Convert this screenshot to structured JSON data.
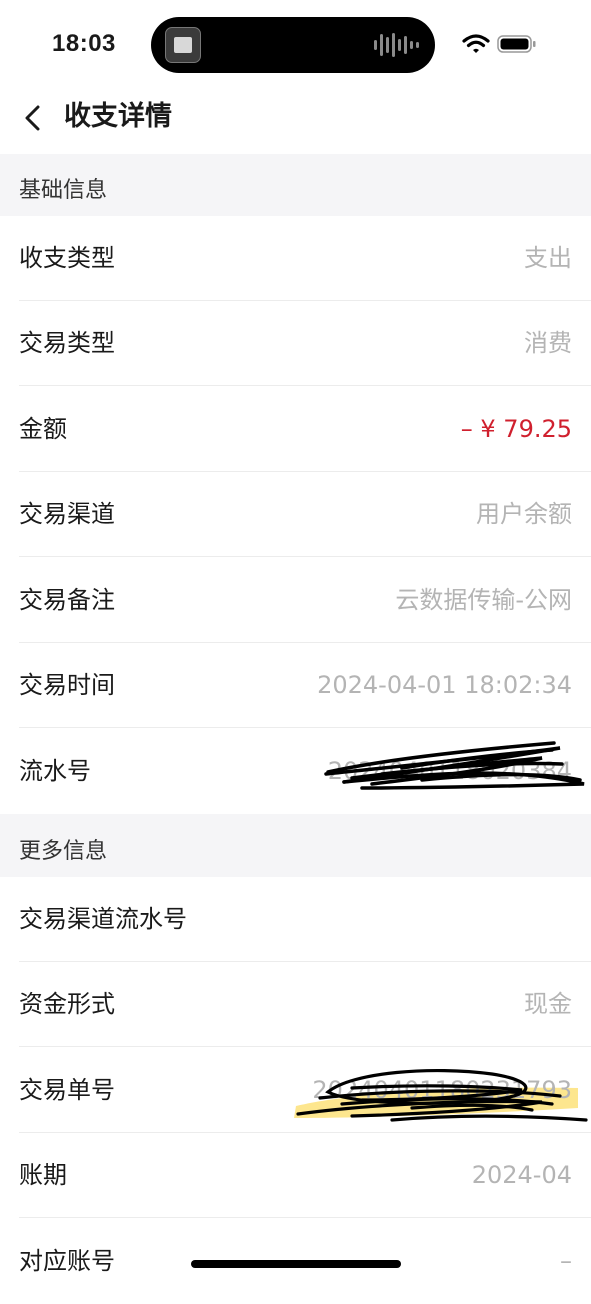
{
  "status_bar": {
    "time": "18:03"
  },
  "nav": {
    "title": "收支详情"
  },
  "sections": [
    {
      "header": "基础信息",
      "rows": [
        {
          "label": "收支类型",
          "value": "支出"
        },
        {
          "label": "交易类型",
          "value": "消费"
        },
        {
          "label": "金额",
          "value": "– ¥ 79.25"
        },
        {
          "label": "交易渠道",
          "value": "用户余额"
        },
        {
          "label": "交易备注",
          "value": "云数据传输-公网"
        },
        {
          "label": "交易时间",
          "value": "2024-04-01 18:02:34"
        },
        {
          "label": "流水号",
          "value": "2024040118020384"
        }
      ]
    },
    {
      "header": "更多信息",
      "rows": [
        {
          "label": "交易渠道流水号",
          "value": ""
        },
        {
          "label": "资金形式",
          "value": "现金"
        },
        {
          "label": "交易单号",
          "value": "20240401180231793"
        },
        {
          "label": "账期",
          "value": "2024-04"
        },
        {
          "label": "对应账号",
          "value": "–"
        }
      ]
    }
  ],
  "colors": {
    "amount": "#d0202e",
    "muted_value": "#b4b4b4",
    "section_bg": "#f5f5f7",
    "highlight": "#fde27a"
  },
  "icons": {
    "back": "chevron-left-icon",
    "wifi": "wifi-icon",
    "battery": "battery-icon"
  }
}
